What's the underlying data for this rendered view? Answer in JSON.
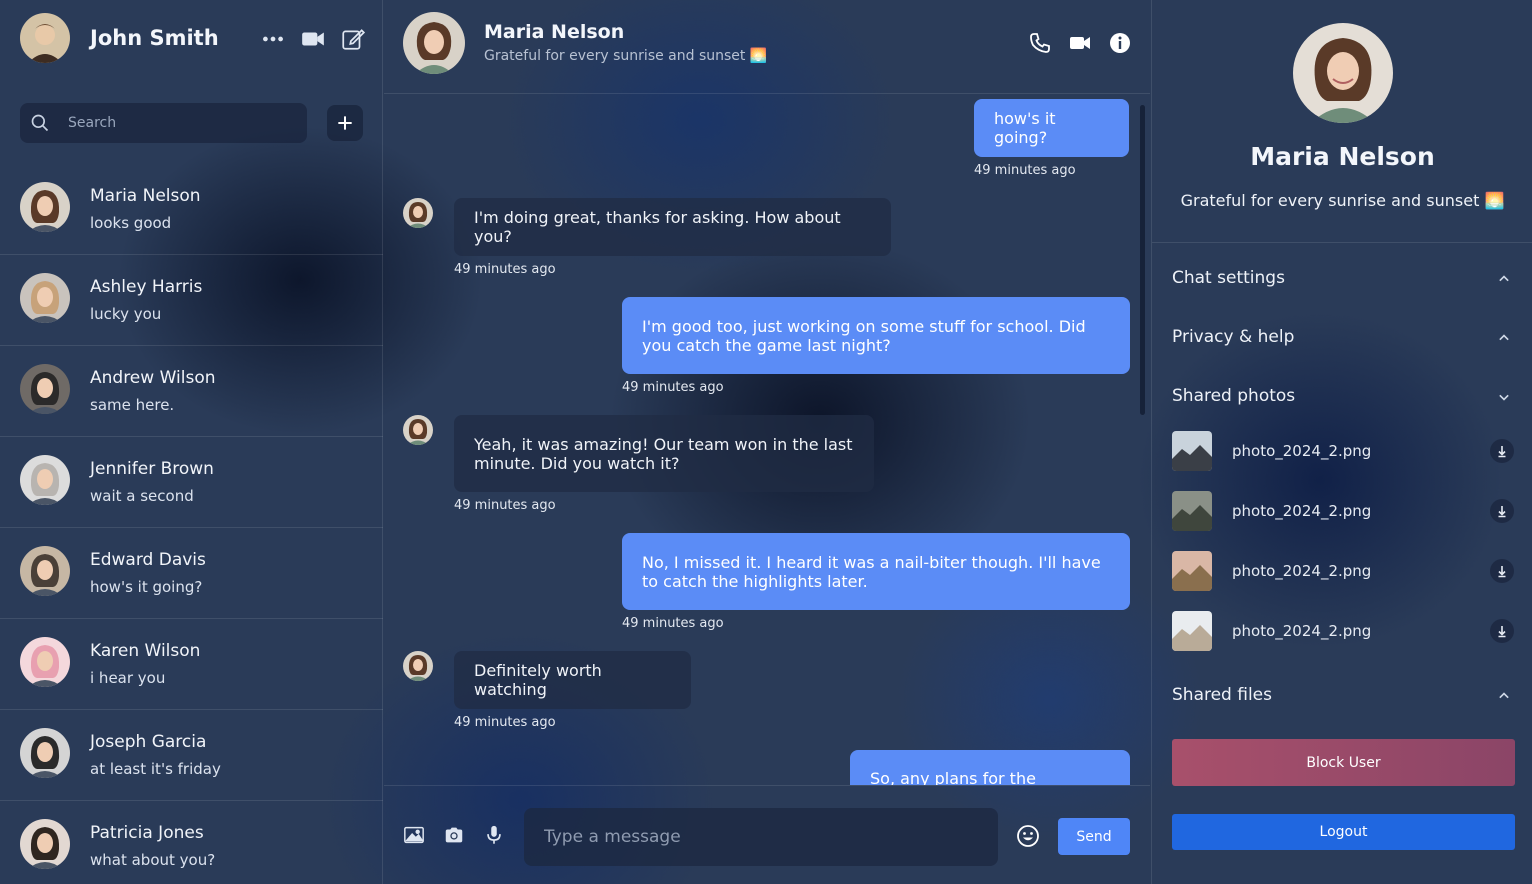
{
  "current_user": {
    "name": "John Smith"
  },
  "search": {
    "placeholder": "Search"
  },
  "contacts": [
    {
      "name": "Maria Nelson",
      "last_message": "looks good",
      "avatar_hair": "#5a3a28",
      "avatar_bg": "#d8d2c8"
    },
    {
      "name": "Ashley Harris",
      "last_message": "lucky you",
      "avatar_hair": "#c7a27a",
      "avatar_bg": "#c9c3bd"
    },
    {
      "name": "Andrew Wilson",
      "last_message": "same here.",
      "avatar_hair": "#2b2a2a",
      "avatar_bg": "#6f6a66"
    },
    {
      "name": "Jennifer Brown",
      "last_message": "wait a second",
      "avatar_hair": "#b8b4b0",
      "avatar_bg": "#dcdcdc"
    },
    {
      "name": "Edward Davis",
      "last_message": "how's it going?",
      "avatar_hair": "#4a4038",
      "avatar_bg": "#c6b7a4"
    },
    {
      "name": "Karen Wilson",
      "last_message": "i hear you",
      "avatar_hair": "#e8a0b0",
      "avatar_bg": "#f4d8dc"
    },
    {
      "name": "Joseph Garcia",
      "last_message": "at least it's friday",
      "avatar_hair": "#2a2a2a",
      "avatar_bg": "#d4d4d4"
    },
    {
      "name": "Patricia Jones",
      "last_message": "what about you?",
      "avatar_hair": "#2f2620",
      "avatar_bg": "#e2d8d2"
    }
  ],
  "chat": {
    "name": "Maria Nelson",
    "status": "Grateful for every sunrise and sunset 🌅",
    "messages": [
      {
        "direction": "out",
        "text": "how's it going?",
        "time": "49 minutes ago"
      },
      {
        "direction": "in",
        "text": "I'm doing great, thanks for asking. How about you?",
        "time": "49 minutes ago"
      },
      {
        "direction": "out",
        "text": "I'm good too, just working on some stuff for school. Did you catch the game last night?",
        "time": "49 minutes ago"
      },
      {
        "direction": "in",
        "text": "Yeah, it was amazing! Our team won in the last minute. Did you watch it?",
        "time": "49 minutes ago"
      },
      {
        "direction": "out",
        "text": "No, I missed it. I heard it was a nail-biter though. I'll have to catch the highlights later.",
        "time": "49 minutes ago"
      },
      {
        "direction": "in",
        "text": "Definitely worth watching",
        "time": "49 minutes ago"
      },
      {
        "direction": "out",
        "text": "So, any plans for the weekend?",
        "time": ""
      }
    ]
  },
  "composer": {
    "placeholder": "Type a message",
    "send_label": "Send"
  },
  "profile": {
    "name": "Maria Nelson",
    "status": "Grateful for every sunrise and sunset 🌅",
    "sections": {
      "chat_settings": "Chat settings",
      "privacy_help": "Privacy & help",
      "shared_photos": "Shared photos",
      "shared_files": "Shared files"
    },
    "photos": [
      {
        "filename": "photo_2024_2.png",
        "colors": [
          "#c9d3dc",
          "#3a3f47"
        ]
      },
      {
        "filename": "photo_2024_2.png",
        "colors": [
          "#8a9087",
          "#3f463d"
        ]
      },
      {
        "filename": "photo_2024_2.png",
        "colors": [
          "#d9b7a6",
          "#8a6f4e"
        ]
      },
      {
        "filename": "photo_2024_2.png",
        "colors": [
          "#e9ecef",
          "#b9ab98"
        ]
      }
    ],
    "block_label": "Block User",
    "logout_label": "Logout"
  },
  "colors": {
    "accent": "#5b8cf6",
    "send": "#4f86f7",
    "block": "#a8506b",
    "logout": "#2067e0"
  }
}
